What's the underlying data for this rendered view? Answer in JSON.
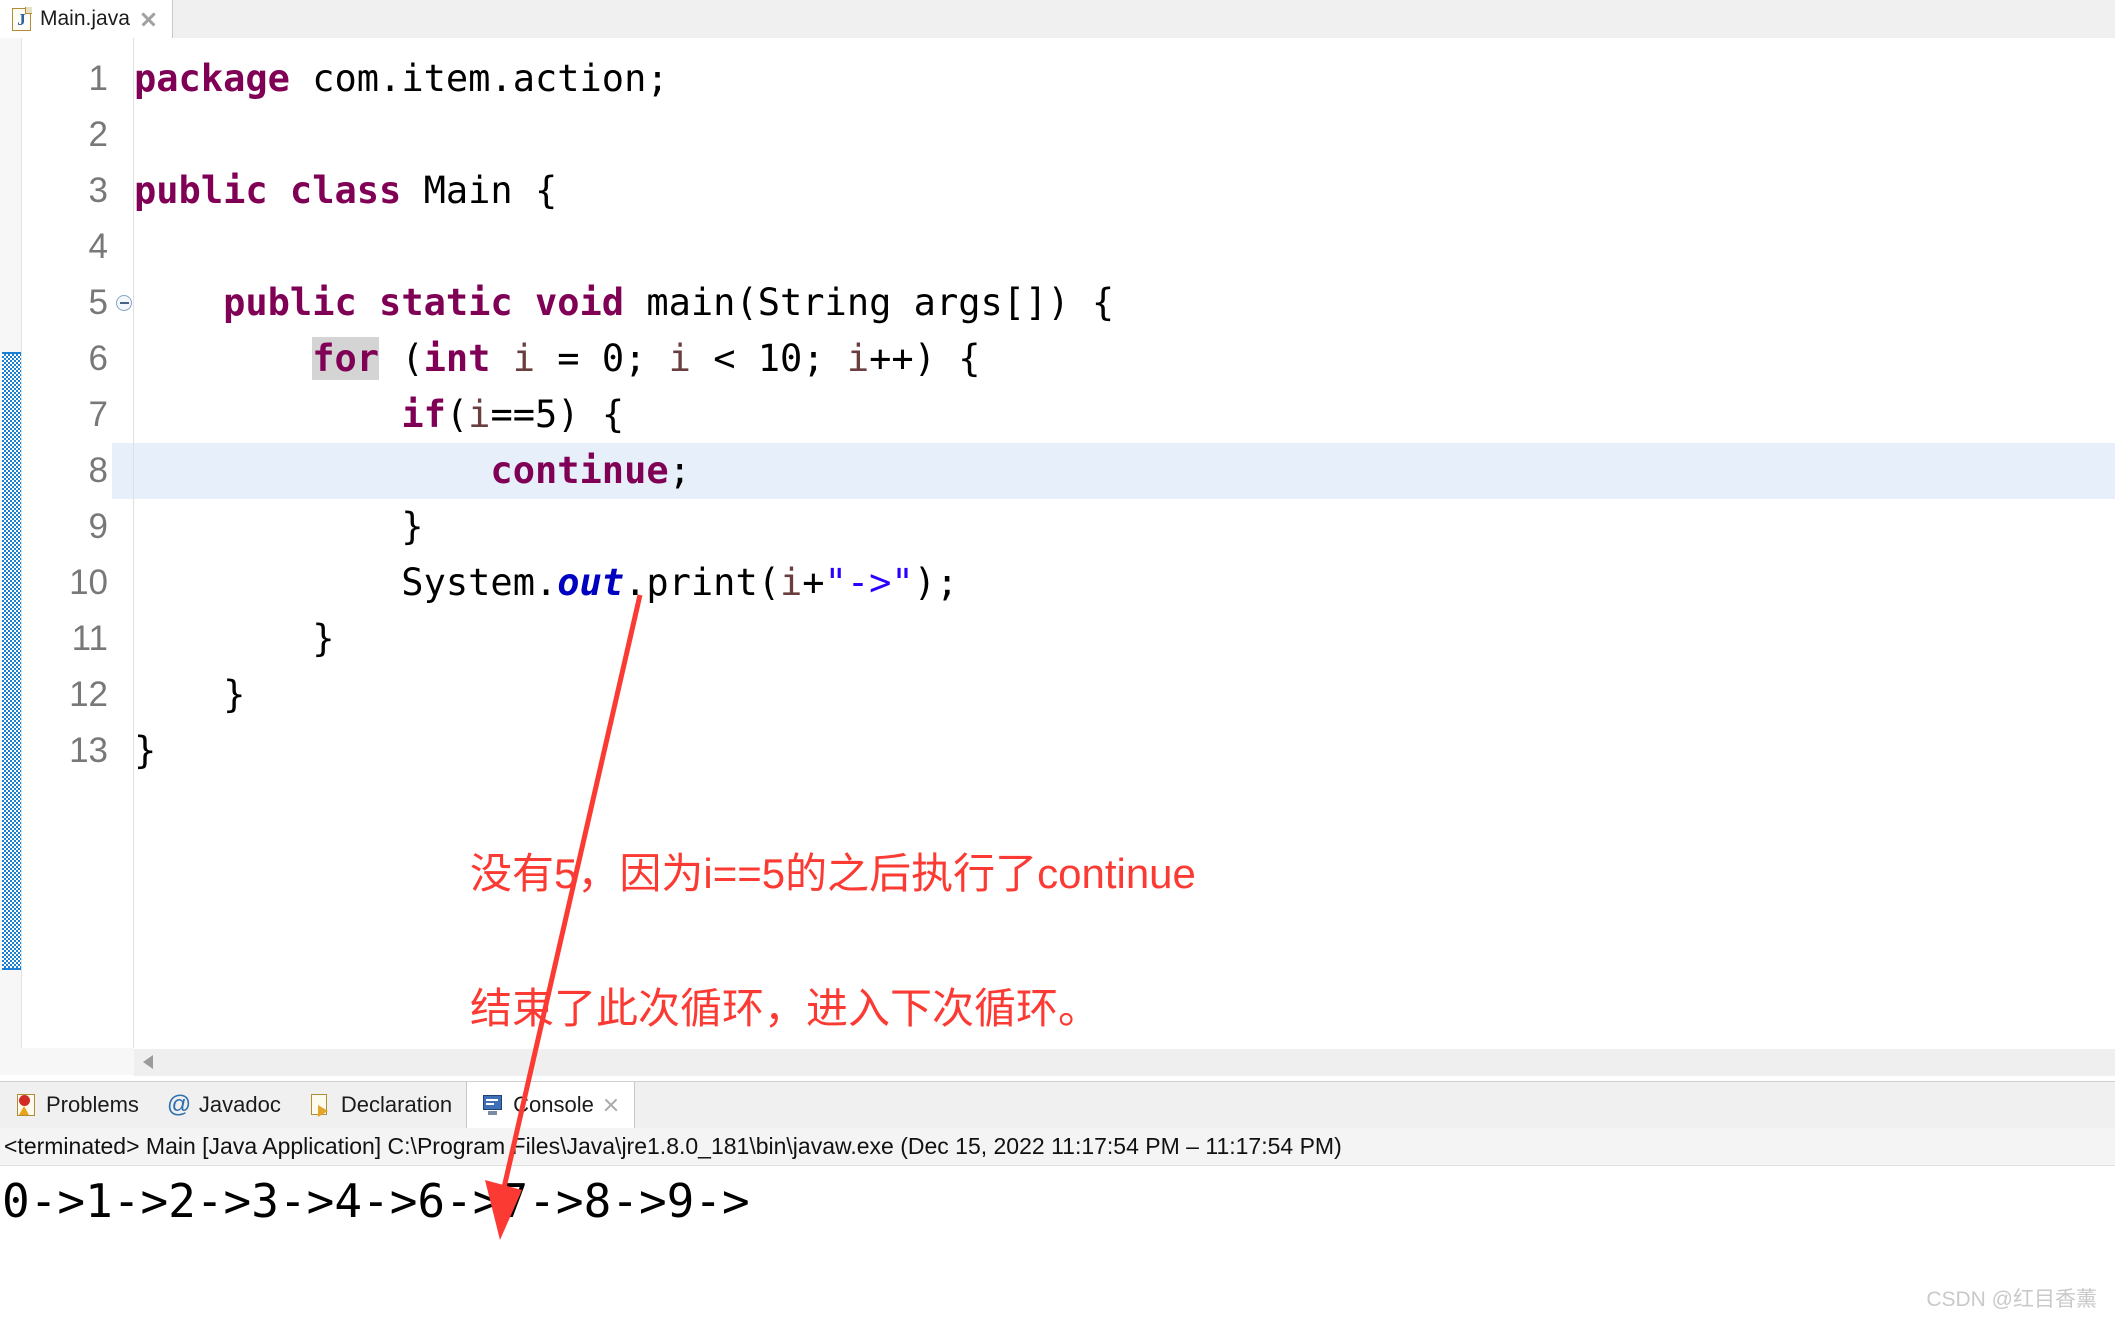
{
  "editor_tab": {
    "filename": "Main.java",
    "icon": "java-file-icon",
    "close_icon": "close-icon"
  },
  "code": {
    "language": "java",
    "highlighted_line": 8,
    "selected_token": "for",
    "fold_marker_line": 5,
    "lines": [
      {
        "n": "1",
        "tokens": [
          {
            "t": "package",
            "c": "kw"
          },
          {
            "t": " com.item.action;",
            "c": "plain"
          }
        ]
      },
      {
        "n": "2",
        "tokens": []
      },
      {
        "n": "3",
        "tokens": [
          {
            "t": "public class",
            "c": "kw"
          },
          {
            "t": " Main {",
            "c": "plain"
          }
        ]
      },
      {
        "n": "4",
        "tokens": []
      },
      {
        "n": "5",
        "tokens": [
          {
            "t": "    ",
            "c": "plain"
          },
          {
            "t": "public static void",
            "c": "kw"
          },
          {
            "t": " main(String args[]) {",
            "c": "plain"
          }
        ]
      },
      {
        "n": "6",
        "tokens": [
          {
            "t": "        ",
            "c": "plain"
          },
          {
            "t": "for",
            "c": "kw-sel"
          },
          {
            "t": " (",
            "c": "plain"
          },
          {
            "t": "int",
            "c": "kw"
          },
          {
            "t": " ",
            "c": "plain"
          },
          {
            "t": "i",
            "c": "loc"
          },
          {
            "t": " = 0; ",
            "c": "plain"
          },
          {
            "t": "i",
            "c": "loc"
          },
          {
            "t": " < 10; ",
            "c": "plain"
          },
          {
            "t": "i",
            "c": "loc"
          },
          {
            "t": "++) {",
            "c": "plain"
          }
        ]
      },
      {
        "n": "7",
        "tokens": [
          {
            "t": "            ",
            "c": "plain"
          },
          {
            "t": "if",
            "c": "kw"
          },
          {
            "t": "(",
            "c": "plain"
          },
          {
            "t": "i",
            "c": "loc"
          },
          {
            "t": "==5) {",
            "c": "plain"
          }
        ]
      },
      {
        "n": "8",
        "tokens": [
          {
            "t": "                ",
            "c": "plain"
          },
          {
            "t": "continue",
            "c": "kw"
          },
          {
            "t": ";",
            "c": "plain"
          }
        ]
      },
      {
        "n": "9",
        "tokens": [
          {
            "t": "            }",
            "c": "plain"
          }
        ]
      },
      {
        "n": "10",
        "tokens": [
          {
            "t": "            System.",
            "c": "plain"
          },
          {
            "t": "out",
            "c": "fld"
          },
          {
            "t": ".print(",
            "c": "plain"
          },
          {
            "t": "i",
            "c": "loc"
          },
          {
            "t": "+",
            "c": "plain"
          },
          {
            "t": "\"->\"",
            "c": "str"
          },
          {
            "t": ");",
            "c": "plain"
          }
        ]
      },
      {
        "n": "11",
        "tokens": [
          {
            "t": "        }",
            "c": "plain"
          }
        ]
      },
      {
        "n": "12",
        "tokens": [
          {
            "t": "    }",
            "c": "plain"
          }
        ]
      },
      {
        "n": "13",
        "tokens": [
          {
            "t": "}",
            "c": "plain"
          }
        ]
      }
    ]
  },
  "annotations": {
    "color": "#fb3b33",
    "note_line_1": "没有5，因为i==5的之后执行了continue",
    "note_line_2": "结束了此次循环，进入下次循环。",
    "arrow_label": "arrow-pointing-to-console-output"
  },
  "bottom_view": {
    "tabs": [
      {
        "label": "Problems",
        "icon": "problems-icon",
        "active": false,
        "closable": false
      },
      {
        "label": "Javadoc",
        "icon": "at-icon",
        "active": false,
        "closable": false
      },
      {
        "label": "Declaration",
        "icon": "declaration-icon",
        "active": false,
        "closable": false
      },
      {
        "label": "Console",
        "icon": "console-icon",
        "active": true,
        "closable": true
      }
    ],
    "terminated_line": "<terminated> Main [Java Application] C:\\Program Files\\Java\\jre1.8.0_181\\bin\\javaw.exe (Dec 15, 2022 11:17:54 PM – 11:17:54 PM)",
    "console_output": "0->1->2->3->4->6->7->8->9->"
  },
  "watermark": "CSDN @红目香薰",
  "colors": {
    "keyword": "#7f0055",
    "string": "#2a00ff",
    "static_field": "#0000c0",
    "local_var": "#6a3e3e",
    "current_line_highlight": "#e6effa",
    "occurrence_highlight": "#d4d4d4",
    "method_range_bar": "#1b7fd4",
    "annotation_red": "#fb3b33"
  }
}
